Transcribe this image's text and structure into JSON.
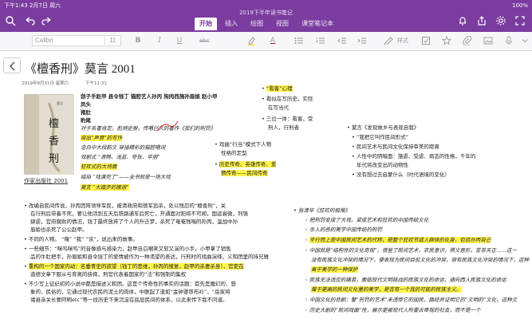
{
  "status": {
    "time": "下午1:43",
    "date": "2月7日 周六",
    "battery": "100%"
  },
  "doc_title": "2019下半年读书笔记",
  "tabs": [
    {
      "label": "开始"
    },
    {
      "label": "插入"
    },
    {
      "label": "绘图"
    },
    {
      "label": "视图"
    },
    {
      "label": "课堂笔记本"
    }
  ],
  "ribbon": {
    "font": "Calibri",
    "size": "11",
    "style": "样式"
  },
  "page": {
    "title": "《檀香刑》莫言   2001",
    "date": "2019年8月31日 星期六",
    "time": "下午11:31",
    "cover_caption": "作家出版社 2001"
  },
  "left_notes": {
    "b1": "刽子手赵甲  县令钱丁  猫腔艺人孙丙  狗肉西施孙眉娘  赵小甲",
    "b2": "凤头",
    "b3": "猪肚",
    "b4": "豹尾",
    "i1": "对于名著肯定，彪炳史册，传唱已久的著作《我们的刑罚》",
    "i2": "突出“声音”的写作",
    "i3": "念白中大段韵文  穿插精彩的猫腔唱词",
    "i4": "戏剧式  “浪畅、浅显、夸张、华丽”",
    "i5": "狂欢式的大场面",
    "i6": "结局  “戏演完了”——全书就是一场大戏",
    "i7": "莫言  “大踏步的撤退”"
  },
  "mid_notes": {
    "m1": "戏曲“行当”模式下人物",
    "m2": "性格的定型",
    "m3": "历史传奇、英雄传奇、爱",
    "m4": "情传奇——民间传奇"
  },
  "top_mid": {
    "a1": "“看客”心理",
    "a2": "看似在写历史，实际",
    "a3": "在写当代",
    "a4": "三位一体：看客，受",
    "a5": "刑人，行刑者"
  },
  "right_notes": {
    "r1": "莫言《发现故乡与表现自我》",
    "r2": "“我把它叫作民间形式”",
    "r3": "民间艺术与民间文化保持审美的距离",
    "r4": "人性中的阴暗面：施虐、受虐、病态的性格，千年的",
    "r5": "年代将改变出的动物性",
    "r6": "没有想过去启蒙什么（时代语境的变化）"
  },
  "bottom_left": [
    "改编自民间传说。孙丙因阵领导军民，被清政府和德军追杀，处以残忍的“檀香刑”，关",
    "在行刑后带着不死，要让他活到五天后铁路通车后死亡，开通面对阳将不可闻，国运衰微，列强",
    "肆虐，官府腐败的情况，钱丁最终放弃了个人的升迁梦，杀死了奄奄残喘的孙丙，温战中孙",
    "眉娘也杀死了公公赵甲。",
    "不同的人物。   “俺”   “我”   “余”，说出来的故事。",
    "一些细节：“咪呜咪呜”的音像感与感染力，赵甲自白嘲笑又软又演的小手，小甲拿了销售",
    "品的牛肚把手，孙眉娘和县令钱丁的爱情被作为一种渴望的表达，行刑时的戏曲演绎，义和团里的持兄雅",
    "重构的一个国家内动：名垂青史的欲望（钱丁的思维，孙丙的报复，赵甲的杀妻杀身），官吏在",
    "道德文章下服从与背离的抉择，刑官代表着国家的“法”和强制的集权",
    "不少写上征纪初的小说中都是描述义和团。这是个传奇性的事实的话题：首先是魔幻的、想",
    "象的、民俗的，它通过现代农民的泥土的肉体，中联起了道如“金钟罩铁布衫”，“岳家将",
    "诸县亲关长要阿明etc”等一段历史下来沉淀在底层民间的体系，以此来传下我不问道。"
  ],
  "bottom_right": [
    "张清华《狂欢的极限》",
    "把刑罚变成了大戏，梁成艺术和狂欢的中国传统文化",
    "杀人的恶的美学中国传统的刑罚",
    "平行而上是中国民间艺术的代称，是整个狂欢节或人群体的化身，包括孙丙自己",
    "中国就是“结构性的文化奇观”，借鉴了民间艺术，农民意识，俱文意形，至茶天正……这一",
    "没有民族文化冲突的情况下，便表现为民间目前文化的冲突，但有民族文化冲突的情况下，这种",
    "高于美学的一种保护",
    "民族无法适应的痛苦，面临现代文明挑战的民族文化的命运，通向西人民族文化的命运",
    "属于更高的民间文化里的美学，是否有一个我的可能的民族主义。",
    "中国文化的悲剧：警“刑罚的艺术”未透惨它的国民，路经并证明它的“文明的”文化，这种文",
    "历史大剧的“民间戏曲”性，展示更被现代人所要去审视的社会，而不是一个"
  ]
}
